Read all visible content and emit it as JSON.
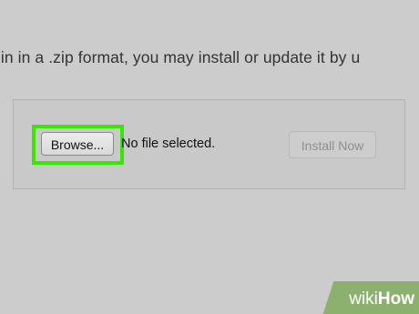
{
  "page": {
    "instruction_text": "gin in a .zip format, you may install or update it by u"
  },
  "upload": {
    "browse_label": "Browse...",
    "file_status": "No file selected.",
    "install_label": "Install Now"
  },
  "watermark": {
    "wiki": "wiki",
    "how": "How"
  },
  "colors": {
    "background": "#cccccc",
    "highlight": "#39e600",
    "watermark": "#8cb06d"
  },
  "icons": {
    "watermark_logo": "wikihow-logo"
  }
}
